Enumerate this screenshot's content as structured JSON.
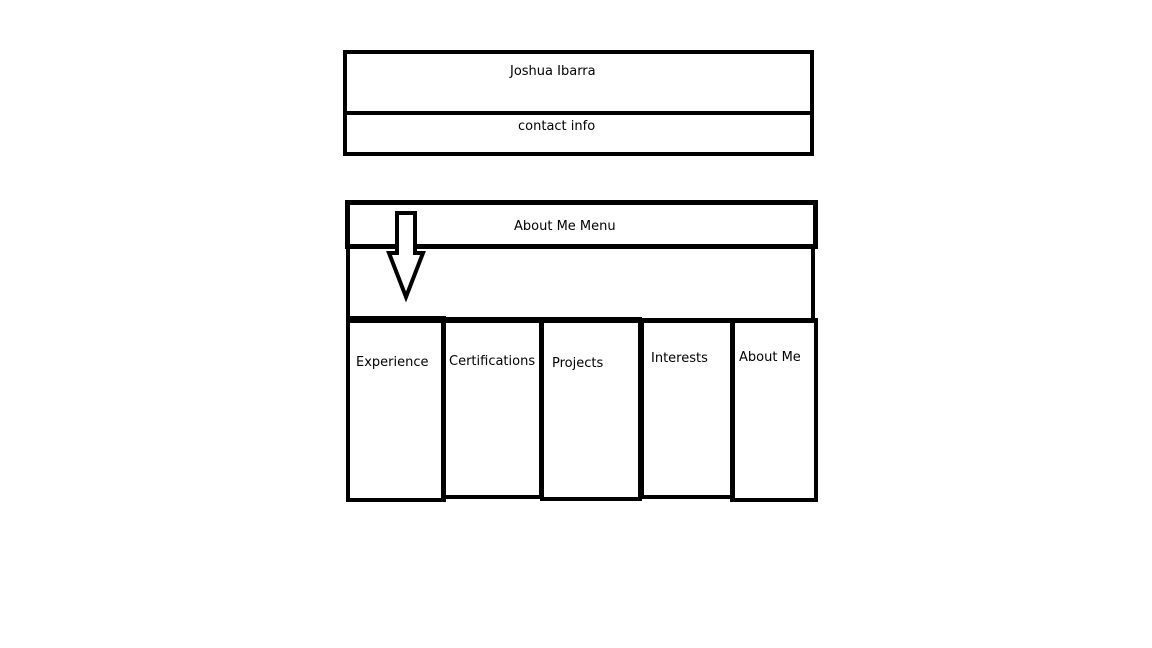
{
  "header": {
    "name": "Joshua Ibarra",
    "contact": "contact info"
  },
  "menu": {
    "title": "About Me Menu",
    "arrow_icon": "down-arrow-icon",
    "items": [
      {
        "label": "Experience"
      },
      {
        "label": "Certifications"
      },
      {
        "label": "Projects"
      },
      {
        "label": "Interests"
      },
      {
        "label": "About Me"
      }
    ]
  }
}
